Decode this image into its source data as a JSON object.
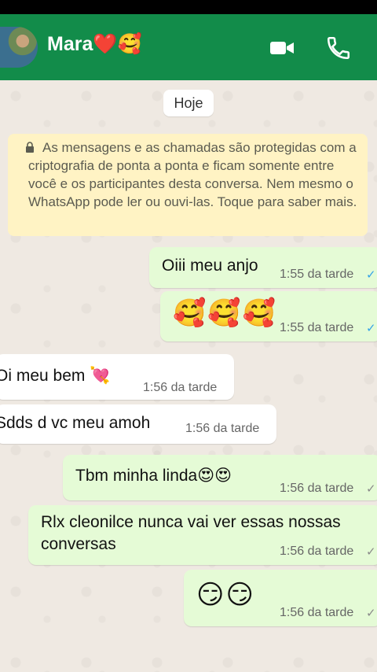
{
  "header": {
    "contact_name": "Mara❤️🥰",
    "video_icon": "video-camera-icon",
    "call_icon": "phone-icon",
    "bg_color": "#128c4a"
  },
  "chat": {
    "date_chip": "Hoje",
    "encryption_notice": "As mensagens e as chamadas são protegidas com a criptografia de ponta a ponta e ficam somente entre você e os participantes desta conversa. Nem mesmo o WhatsApp pode ler ou ouvi-las. Toque para saber mais.",
    "messages": [
      {
        "direction": "out",
        "text": "Oiii meu anjo",
        "time": "1:55 da tarde",
        "status": "read"
      },
      {
        "direction": "out",
        "text": "🥰🥰🥰",
        "time": "1:55 da tarde",
        "status": "read"
      },
      {
        "direction": "in",
        "text": "Oi meu bem 💘",
        "time": "1:56 da tarde"
      },
      {
        "direction": "in",
        "text": "Sdds d vc meu amoh",
        "time": "1:56 da tarde"
      },
      {
        "direction": "out",
        "text": "Tbm minha linda😍😍",
        "time": "1:56 da tarde",
        "status": "delivered"
      },
      {
        "direction": "out",
        "text": "Rlx cleonilce nunca vai ver essas nossas conversas",
        "time": "1:56 da tarde",
        "status": "delivered"
      },
      {
        "direction": "out",
        "text": "😏😏",
        "time": "1:56 da tarde",
        "status": "delivered"
      }
    ]
  },
  "colors": {
    "outgoing_bubble": "#e5fbd6",
    "incoming_bubble": "#ffffff",
    "read_tick": "#35a3e8"
  }
}
